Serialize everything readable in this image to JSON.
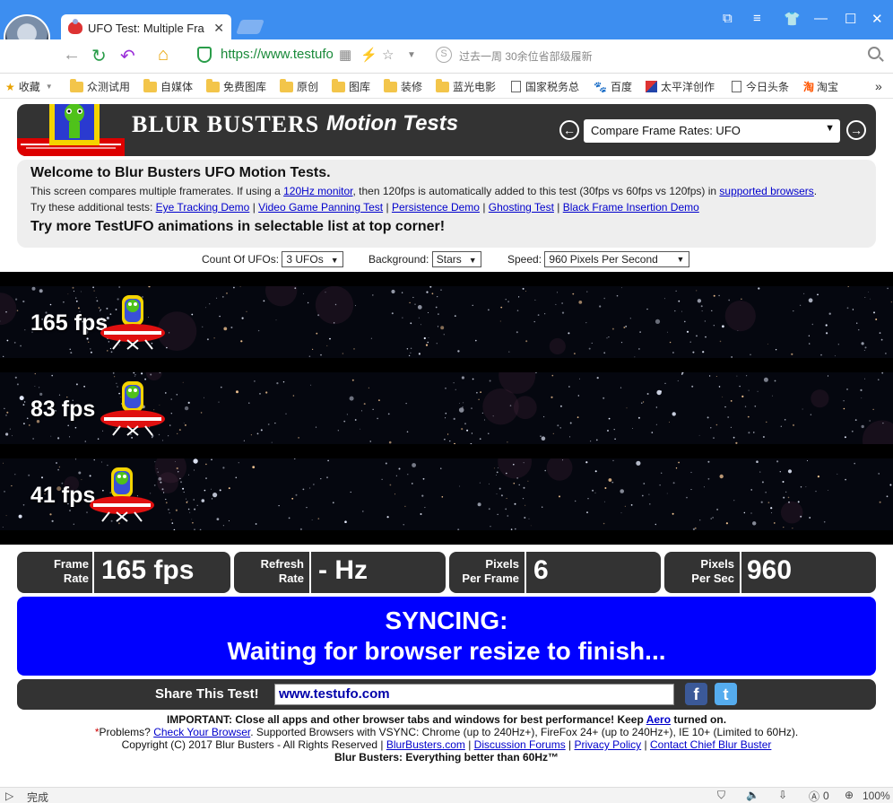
{
  "browser": {
    "tab_title": "UFO Test: Multiple Fra",
    "url": "https://www.testufo",
    "search_hint": "过去一周 30余位省部级履新",
    "status": "完成",
    "zoom": "100%",
    "ad_count": "0"
  },
  "bookmarks": [
    {
      "label": "收藏"
    },
    {
      "label": "众测试用"
    },
    {
      "label": "自媒体"
    },
    {
      "label": "免费图库"
    },
    {
      "label": "原创"
    },
    {
      "label": "图库"
    },
    {
      "label": "装修"
    },
    {
      "label": "蓝光电影"
    },
    {
      "label": "国家税务总"
    },
    {
      "label": "百度"
    },
    {
      "label": "太平洋创作"
    },
    {
      "label": "今日头条"
    },
    {
      "label": "淘宝"
    }
  ],
  "banner": {
    "brand": "BLUR BUSTERS",
    "subtitle": "Motion Tests",
    "compare_select": "Compare Frame Rates: UFO",
    "colors": {
      "bar": "#333333"
    }
  },
  "info": {
    "title": "Welcome to Blur Busters UFO Motion Tests.",
    "line1_pre": "This screen compares multiple framerates. If using a",
    "line1_link": "120Hz monitor",
    "line1_mid": ", then 120fps is automatically added to this test (30fps vs 60fps vs 120fps) in",
    "line1_link2": "supported browsers",
    "line1_post": ".",
    "line2_pre": "Try these additional tests:",
    "tests": [
      "Eye Tracking Demo",
      "Video Game Panning Test",
      "Persistence Demo",
      "Ghosting Test",
      "Black Frame Insertion Demo"
    ],
    "big": "Try more TestUFO animations in selectable list at top corner!"
  },
  "controls": {
    "count_label": "Count Of UFOs:",
    "count_value": "3 UFOs",
    "background_label": "Background:",
    "background_value": "Stars",
    "speed_label": "Speed:",
    "speed_value": "960 Pixels Per Second"
  },
  "lanes": [
    {
      "fps": "165 fps"
    },
    {
      "fps": "83 fps"
    },
    {
      "fps": "41 fps"
    }
  ],
  "stats": {
    "frame_rate_label1": "Frame",
    "frame_rate_label2": "Rate",
    "frame_rate_value": "165 fps",
    "refresh_label1": "Refresh",
    "refresh_label2": "Rate",
    "refresh_value": "- Hz",
    "ppf_label1": "Pixels",
    "ppf_label2": "Per Frame",
    "ppf_value": "6",
    "pps_label1": "Pixels",
    "pps_label2": "Per Sec",
    "pps_value": "960"
  },
  "syncing": {
    "line1": "SYNCING:",
    "line2": "Waiting for browser resize to finish...",
    "color": "#0000ff"
  },
  "share": {
    "label": "Share This Test!",
    "value": "www.testufo.com"
  },
  "footer": {
    "important": "IMPORTANT: Close all apps and other browser tabs and windows for best performance! Keep",
    "aero": "Aero",
    "important_post": "turned on.",
    "problems_pre": "Problems?",
    "check_browser": "Check Your Browser",
    "problems_post": ". Supported Browsers with VSYNC: Chrome (up to 240Hz+), FireFox 24+ (up to 240Hz+), IE 10+ (Limited to 60Hz).",
    "copyright": "Copyright (C) 2017 Blur Busters - All Rights Reserved |",
    "links": [
      "BlurBusters.com",
      "Discussion Forums",
      "Privacy Policy",
      "Contact Chief Blur Buster"
    ],
    "tagline": "Blur Busters: Everything better than 60Hz™"
  }
}
